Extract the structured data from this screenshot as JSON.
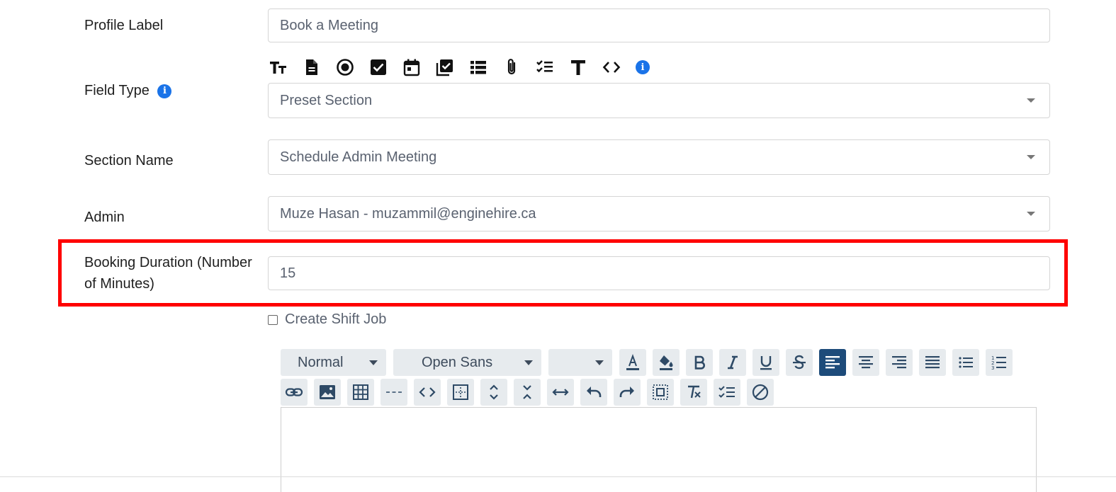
{
  "form": {
    "profile_label": {
      "label": "Profile Label",
      "value": "Book a Meeting"
    },
    "field_type": {
      "label": "Field Type",
      "value": "Preset Section"
    },
    "section_name": {
      "label": "Section Name",
      "value": "Schedule Admin Meeting"
    },
    "admin": {
      "label": "Admin",
      "value": "Muze Hasan - muzammil@enginehire.ca"
    },
    "booking_duration": {
      "label_line1": "Booking Duration (Number",
      "label_line2": "of Minutes)",
      "value": "15"
    },
    "create_shift_job": {
      "label": "Create Shift Job",
      "checked": false
    }
  },
  "field_type_icons": [
    "text-size-icon",
    "document-icon",
    "radio-icon",
    "checkbox-icon",
    "calendar-icon",
    "multi-checkbox-icon",
    "list-icon",
    "attachment-icon",
    "checklist-icon",
    "text-icon",
    "code-icon",
    "info-icon"
  ],
  "editor": {
    "format_select": "Normal",
    "font_select": "Open Sans",
    "size_select": "",
    "active_color": "#1d4b7a"
  },
  "colors": {
    "highlight": "#ff0000",
    "info": "#1a73e8"
  }
}
